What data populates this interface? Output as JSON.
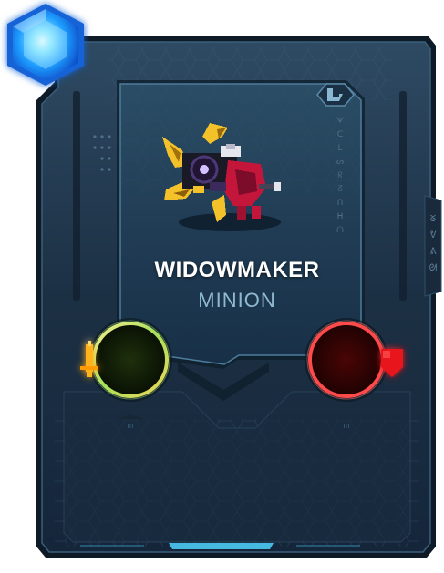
{
  "card": {
    "name": "WIDOWMAKER",
    "type": "MINION"
  },
  "stats": {
    "attack_value": "",
    "health_value": ""
  },
  "icons": {
    "mana_gem": "blue-hexagon-gem",
    "rarity": "rarity-emblem",
    "attack": "sword-icon",
    "health": "shield-icon"
  },
  "colors": {
    "frame": "#1f3346",
    "frame_edge": "#0d1a26",
    "accent_cyan": "#4fd3ff",
    "attack_ring": "#e7e07a",
    "attack_orb": "#0f1a06",
    "health_ring": "#ff4a4a",
    "health_orb": "#2a0303",
    "sword": "#ffb21e",
    "shield": "#e8141e",
    "name_text": "#ffffff",
    "type_text": "#8fb9cf"
  }
}
